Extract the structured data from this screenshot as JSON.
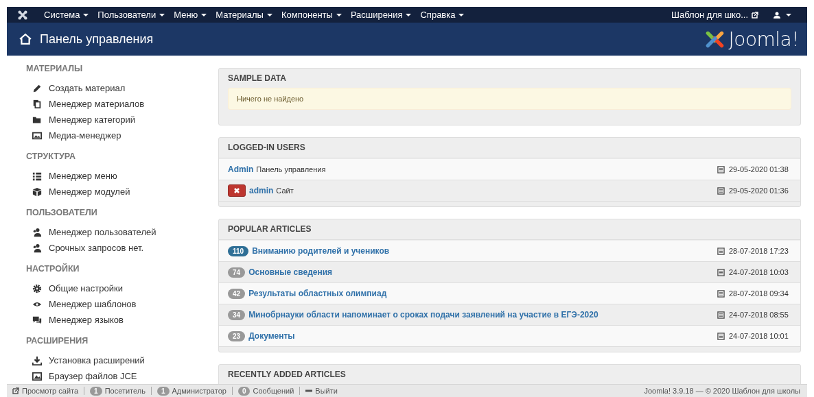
{
  "top_menu": {
    "items": [
      {
        "label": "Система"
      },
      {
        "label": "Пользователи"
      },
      {
        "label": "Меню"
      },
      {
        "label": "Материалы"
      },
      {
        "label": "Компоненты"
      },
      {
        "label": "Расширения"
      },
      {
        "label": "Справка"
      }
    ],
    "site_link": "Шаблон для шко..."
  },
  "header": {
    "title": "Панель управления",
    "brand": "Joomla!"
  },
  "sidebar": [
    {
      "heading": "МАТЕРИАЛЫ",
      "items": [
        "Создать материал",
        "Менеджер материалов",
        "Менеджер категорий",
        "Медиа-менеджер"
      ]
    },
    {
      "heading": "СТРУКТУРА",
      "items": [
        "Менеджер меню",
        "Менеджер модулей"
      ]
    },
    {
      "heading": "ПОЛЬЗОВАТЕЛИ",
      "items": [
        "Менеджер пользователей",
        "Срочных запросов нет."
      ]
    },
    {
      "heading": "НАСТРОЙКИ",
      "items": [
        "Общие настройки",
        "Менеджер шаблонов",
        "Менеджер языков"
      ]
    },
    {
      "heading": "РАСШИРЕНИЯ",
      "items": [
        "Установка расширений",
        "Браузер файлов JCE"
      ]
    }
  ],
  "panels": [
    {
      "kind": "message",
      "title": "SAMPLE DATA",
      "message": "Ничего не найдено"
    },
    {
      "kind": "users",
      "title": "LOGGED-IN USERS",
      "rows": [
        {
          "name": "Admin",
          "place": "Панель управления",
          "date": "29-05-2020 01:38",
          "logout_button": false
        },
        {
          "name": "admin",
          "place": "Сайт",
          "date": "29-05-2020 01:36",
          "logout_button": true
        }
      ]
    },
    {
      "kind": "articles",
      "title": "POPULAR ARTICLES",
      "rows": [
        {
          "hits": "110",
          "color": "#2f6f96",
          "title": "Вниманию родителей и учеников",
          "date": "28-07-2018 17:23"
        },
        {
          "hits": "74",
          "color": "#999999",
          "title": "Основные сведения",
          "date": "24-07-2018 10:03"
        },
        {
          "hits": "42",
          "color": "#999999",
          "title": "Результаты областных олимпиад",
          "date": "28-07-2018 09:34"
        },
        {
          "hits": "34",
          "color": "#999999",
          "title": "Минобрнауки области напоминает о сроках подачи заявлений на участие в ЕГЭ-2020",
          "date": "24-07-2018 08:55"
        },
        {
          "hits": "23",
          "color": "#999999",
          "title": "Документы",
          "date": "24-07-2018 10:01"
        }
      ]
    },
    {
      "kind": "articles",
      "title": "RECENTLY ADDED ARTICLES"
    }
  ],
  "status_bar": {
    "items": [
      {
        "kind": "link",
        "label": "Просмотр сайта"
      },
      {
        "kind": "count",
        "count": "1",
        "label": "Посетитель"
      },
      {
        "kind": "count",
        "count": "1",
        "label": "Администратор"
      },
      {
        "kind": "count",
        "count": "0",
        "label": "Сообщений"
      },
      {
        "kind": "logout",
        "label": "Выйти"
      }
    ],
    "version": "Joomla! 3.9.18 — © 2020 Шаблон для школы"
  }
}
